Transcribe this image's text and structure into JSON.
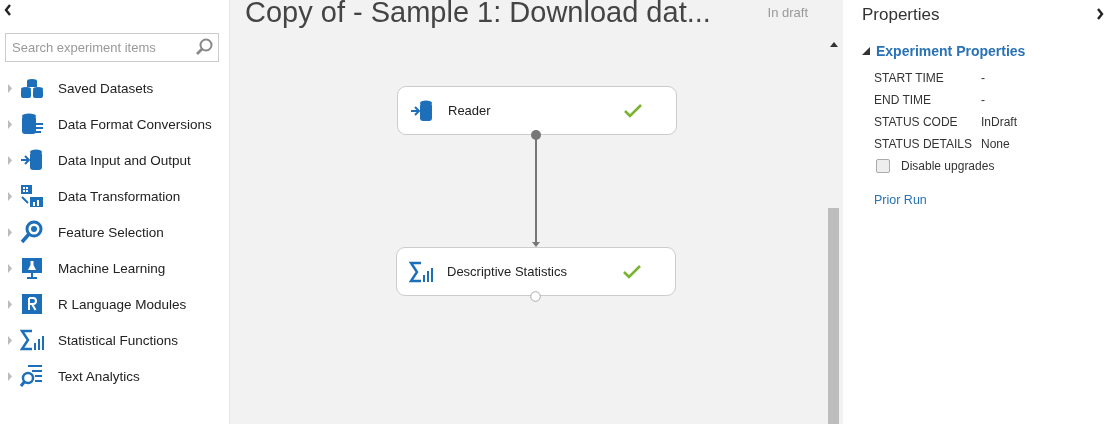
{
  "palette": {
    "search": {
      "placeholder": "Search experiment items"
    },
    "items": [
      {
        "label": "Saved Datasets",
        "expanded": false
      },
      {
        "label": "Data Format Conversions",
        "expanded": false
      },
      {
        "label": "Data Input and Output",
        "expanded": false
      },
      {
        "label": "Data Transformation",
        "expanded": false
      },
      {
        "label": "Feature Selection",
        "expanded": false
      },
      {
        "label": "Machine Learning",
        "expanded": false
      },
      {
        "label": "R Language Modules",
        "expanded": false
      },
      {
        "label": "Statistical Functions",
        "expanded": false
      },
      {
        "label": "Text Analytics",
        "expanded": false
      }
    ]
  },
  "canvas": {
    "title": "Copy of - Sample 1: Download dat...",
    "status": "In draft",
    "nodes": [
      {
        "label": "Reader",
        "done": true
      },
      {
        "label": "Descriptive Statistics",
        "done": true
      }
    ]
  },
  "properties": {
    "title": "Properties",
    "section": {
      "label": "Experiment Properties",
      "expanded": true
    },
    "rows": [
      {
        "label": "START TIME",
        "value": "-"
      },
      {
        "label": "END TIME",
        "value": "-"
      },
      {
        "label": "STATUS CODE",
        "value": "InDraft"
      },
      {
        "label": "STATUS DETAILS",
        "value": "None"
      }
    ],
    "checkbox": {
      "label": "Disable upgrades",
      "checked": false
    },
    "link": "Prior Run"
  }
}
